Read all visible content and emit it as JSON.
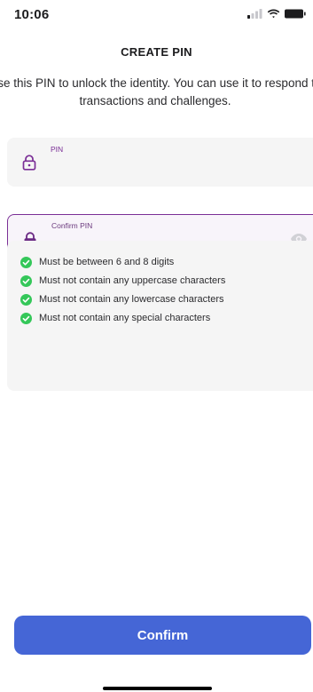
{
  "status_bar": {
    "time": "10:06"
  },
  "page": {
    "title": "CREATE PIN",
    "description": "Use this PIN to unlock the identity. You can use it to respond to transactions and challenges."
  },
  "fields": {
    "pin": {
      "label": "PIN",
      "value": ""
    },
    "confirm_pin": {
      "label": "Confirm PIN",
      "value": ""
    }
  },
  "rules": [
    {
      "text": "Must be between 6 and 8 digits",
      "satisfied": true
    },
    {
      "text": "Must not contain any uppercase characters",
      "satisfied": true
    },
    {
      "text": "Must not contain any lowercase characters",
      "satisfied": true
    },
    {
      "text": "Must not contain any special characters",
      "satisfied": true
    }
  ],
  "actions": {
    "confirm_label": "Confirm"
  },
  "icons": {
    "lock": "lock-icon",
    "eye": "eye-icon",
    "check": "check-circle-icon"
  },
  "colors": {
    "accent_purple": "#7b2f96",
    "button_blue": "#4566d6",
    "check_green": "#34c759"
  }
}
